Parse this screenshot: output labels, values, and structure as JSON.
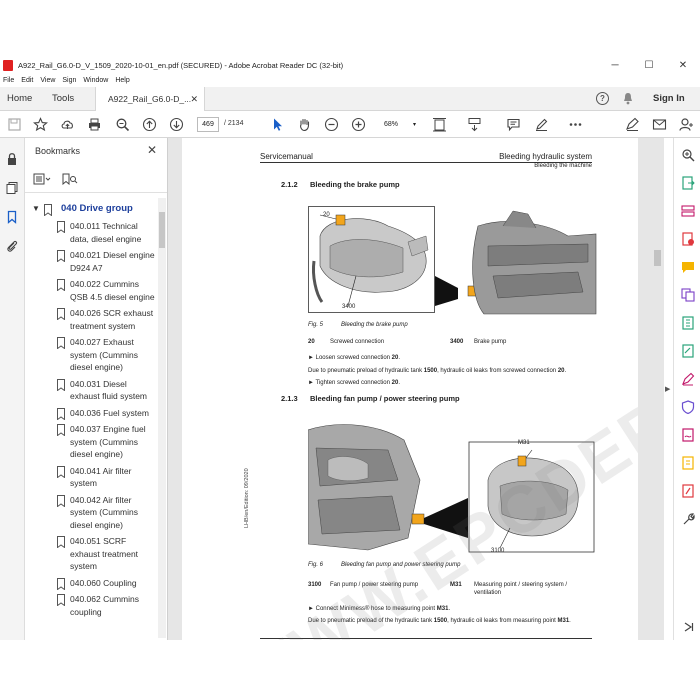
{
  "window": {
    "title": "A922_Rail_G6.0-D_V_1509_2020-10-01_en.pdf (SECURED) - Adobe Acrobat Reader DC (32-bit)",
    "minimize": "─",
    "maximize": "☐",
    "close": "✕"
  },
  "menu": [
    "File",
    "Edit",
    "View",
    "Sign",
    "Window",
    "Help"
  ],
  "tabs": {
    "home": "Home",
    "tools": "Tools",
    "document": "A922_Rail_G6.0-D_...",
    "close": "✕",
    "sign_in": "Sign In"
  },
  "toolbar": {
    "page_current": "469",
    "page_total": "/  2134",
    "zoom": "68%"
  },
  "bookmarks": {
    "title": "Bookmarks",
    "close": "✕",
    "parent": "040 Drive group",
    "items": [
      "040.011 Technical data, diesel engine",
      "040.021 Diesel engine D924 A7",
      "040.022 Cummins QSB 4.5 diesel engine",
      "040.026 SCR exhaust treatment system",
      "040.027 Exhaust system (Cummins diesel engine)",
      "040.031 Diesel exhaust fluid system",
      "040.036 Fuel system",
      "040.037 Engine fuel system (Cummins diesel engine)",
      "040.041 Air filter system",
      "040.042 Air filter system (Cummins diesel engine)",
      "040.051 SCRF exhaust treatment system",
      "040.060 Coupling",
      "040.062 Cummins coupling"
    ]
  },
  "page": {
    "header_left": "Servicemanual",
    "header_right": "Bleeding hydraulic system",
    "header_right_sub": "Bleeding the machine",
    "s1_num": "2.1.2",
    "s1_title": "Bleeding the brake pump",
    "fig5_label_a": "20",
    "fig5_label_b": "3400",
    "fig5_num": "Fig. 5",
    "fig5_caption": "Bleeding the brake pump",
    "leg1_num": "20",
    "leg1_text": "Screwed connection",
    "leg2_num": "3400",
    "leg2_text": "Brake pump",
    "step1_a": "►  Loosen screwed connection ",
    "step1_b": "20",
    "step1_c": ".",
    "note1_a": "Due to pneumatic preload of hydraulic tank ",
    "note1_b": "1500",
    "note1_c": ", hydraulic oil leaks from screwed connection ",
    "note1_d": "20",
    "note1_e": ".",
    "step2_a": "►  Tighten screwed connection ",
    "step2_b": "20",
    "step2_c": ".",
    "s2_num": "2.1.3",
    "s2_title": "Bleeding fan pump / power steering pump",
    "fig6_label_a": "M31",
    "fig6_label_b": "3100",
    "fig6_num": "Fig. 6",
    "fig6_caption": "Bleeding fan pump and power steering pump",
    "leg3_num": "3100",
    "leg3_text": "Fan pump / power steering pump",
    "leg4_num": "M31",
    "leg4_text_1": "Measuring point / steering system /",
    "leg4_text_2": "ventilation",
    "step3_a": "►  Connect Minimess® hose to measuring point ",
    "step3_b": "M31",
    "step3_c": ".",
    "note2_a": "Due to pneumatic preload of the hydraulic tank ",
    "note2_b": "1500",
    "note2_c": ", hydraulic oil leaks from measuring point ",
    "note2_d": "M31",
    "note2_e": ".",
    "side_text": "LHB/en/Edition: 09/2020",
    "watermark": "WWW.EPCDEPO.COM"
  }
}
